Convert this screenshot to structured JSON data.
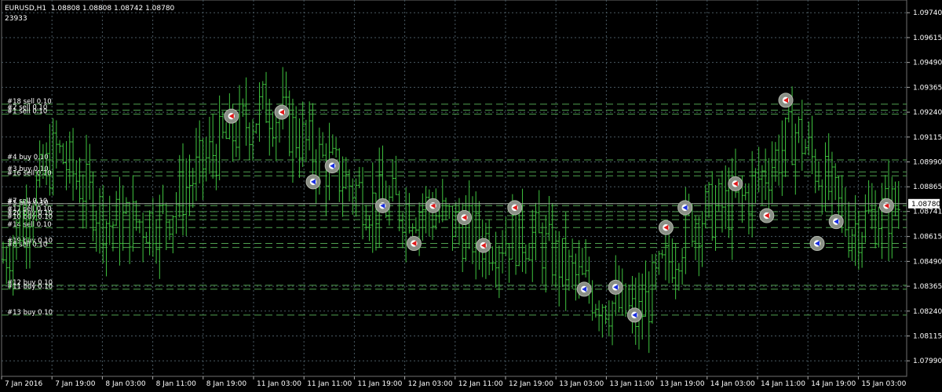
{
  "header": {
    "symbol_line": "EURUSD,H1  1.08808 1.08808 1.08742 1.08780",
    "counter": "23933"
  },
  "colors": {
    "background": "#000000",
    "grid": "#4a5a63",
    "bar": "#3fc33f",
    "order_line": "#4fa04f",
    "axis_text": "#ffffff",
    "price_box_bg": "#ffffff",
    "price_box_text": "#000000",
    "buy_arrow": "#1a2fe0",
    "sell_arrow": "#e01a1a",
    "marker_ring": "#8a8f86"
  },
  "price_axis": {
    "labels": [
      "1.09740",
      "1.09615",
      "1.09490",
      "1.09365",
      "1.09240",
      "1.09115",
      "1.08990",
      "1.08865",
      "1.08741",
      "1.08615",
      "1.08490",
      "1.08365",
      "1.08240",
      "1.08115",
      "1.07990"
    ],
    "current_price": "1.08780"
  },
  "time_axis": {
    "labels": [
      "7 Jan 2016",
      "7 Jan 19:00",
      "8 Jan 03:00",
      "8 Jan 11:00",
      "8 Jan 19:00",
      "11 Jan 03:00",
      "11 Jan 11:00",
      "11 Jan 19:00",
      "12 Jan 03:00",
      "12 Jan 11:00",
      "12 Jan 19:00",
      "13 Jan 03:00",
      "13 Jan 11:00",
      "13 Jan 19:00",
      "14 Jan 03:00",
      "14 Jan 11:00",
      "14 Jan 19:00",
      "15 Jan 03:00"
    ]
  },
  "order_labels": [
    {
      "text": "#18 sell 0.10",
      "price": 1.0928
    },
    {
      "text": "#2 sell 0.10",
      "price": 1.0925
    },
    {
      "text": "#1 sell 0.10",
      "price": 1.0923
    },
    {
      "text": "#4 buy 0.10",
      "price": 1.09
    },
    {
      "text": "#3 buy 0.10",
      "price": 1.0894
    },
    {
      "text": "#16 sell 0.10",
      "price": 1.0892
    },
    {
      "text": "#7 sell 0.10",
      "price": 1.0878
    },
    {
      "text": "#5 buy 0.10",
      "price": 1.0877
    },
    {
      "text": "#17 sell 0.10",
      "price": 1.0874
    },
    {
      "text": "#20 buy 0.10",
      "price": 1.0872
    },
    {
      "text": "#10 buy 0.10",
      "price": 1.087
    },
    {
      "text": "#14 sell 0.10",
      "price": 1.0866
    },
    {
      "text": "#19 buy 0.10",
      "price": 1.0858
    },
    {
      "text": "#6 sell 0.10",
      "price": 1.0856
    },
    {
      "text": "#12 buy 0.10",
      "price": 1.0837
    },
    {
      "text": "#11 buy 0.10",
      "price": 1.0835
    },
    {
      "text": "#13 buy 0.10",
      "price": 1.0822
    }
  ],
  "trade_markers": [
    {
      "time": "8 Jan 19:00",
      "price": 1.0922,
      "side": "sell"
    },
    {
      "time": "11 Jan 03:00",
      "price": 1.0924,
      "side": "sell"
    },
    {
      "time": "11 Jan 03:00",
      "price": 1.0889,
      "side": "buy"
    },
    {
      "time": "11 Jan 11:00",
      "price": 1.0897,
      "side": "buy"
    },
    {
      "time": "11 Jan 19:00",
      "price": 1.0877,
      "side": "buy"
    },
    {
      "time": "11 Jan 19:00",
      "price": 1.0858,
      "side": "sell"
    },
    {
      "time": "12 Jan 03:00",
      "price": 1.0877,
      "side": "sell"
    },
    {
      "time": "12 Jan 03:00",
      "price": 1.0871,
      "side": "sell"
    },
    {
      "time": "12 Jan 11:00",
      "price": 1.0857,
      "side": "sell"
    },
    {
      "time": "12 Jan 11:00",
      "price": 1.0876,
      "side": "sell"
    },
    {
      "time": "13 Jan 03:00",
      "price": 1.0835,
      "side": "buy"
    },
    {
      "time": "13 Jan 03:00",
      "price": 1.0836,
      "side": "buy"
    },
    {
      "time": "13 Jan 11:00",
      "price": 1.0822,
      "side": "buy"
    },
    {
      "time": "13 Jan 11:00",
      "price": 1.0866,
      "side": "sell"
    },
    {
      "time": "13 Jan 19:00",
      "price": 1.0876,
      "side": "buy"
    },
    {
      "time": "14 Jan 03:00",
      "price": 1.0888,
      "side": "sell"
    },
    {
      "time": "14 Jan 03:00",
      "price": 1.0872,
      "side": "sell"
    },
    {
      "time": "14 Jan 11:00",
      "price": 1.093,
      "side": "sell"
    },
    {
      "time": "14 Jan 11:00",
      "price": 1.0858,
      "side": "buy"
    },
    {
      "time": "14 Jan 19:00",
      "price": 1.0869,
      "side": "buy"
    },
    {
      "time": "15 Jan 03:00",
      "price": 1.0877,
      "side": "sell"
    }
  ],
  "chart_data": {
    "type": "ohlc",
    "symbol": "EURUSD",
    "timeframe": "H1",
    "last_bar": {
      "open": 1.08808,
      "high": 1.08808,
      "low": 1.08742,
      "close": 1.0878
    },
    "ylim": [
      1.0792,
      1.098
    ],
    "grid": true,
    "x": [
      "7 Jan 2016",
      "7 Jan 19:00",
      "8 Jan 03:00",
      "8 Jan 11:00",
      "8 Jan 19:00",
      "11 Jan 03:00",
      "11 Jan 11:00",
      "11 Jan 19:00",
      "12 Jan 03:00",
      "12 Jan 11:00",
      "12 Jan 19:00",
      "13 Jan 03:00",
      "13 Jan 11:00",
      "13 Jan 19:00",
      "14 Jan 03:00",
      "14 Jan 11:00",
      "14 Jan 19:00",
      "15 Jan 03:00"
    ],
    "close": [
      1.085,
      1.0905,
      1.0868,
      1.087,
      1.0905,
      1.0928,
      1.09,
      1.0878,
      1.0876,
      1.086,
      1.0862,
      1.0836,
      1.082,
      1.087,
      1.088,
      1.0915,
      1.0866,
      1.0878
    ]
  }
}
